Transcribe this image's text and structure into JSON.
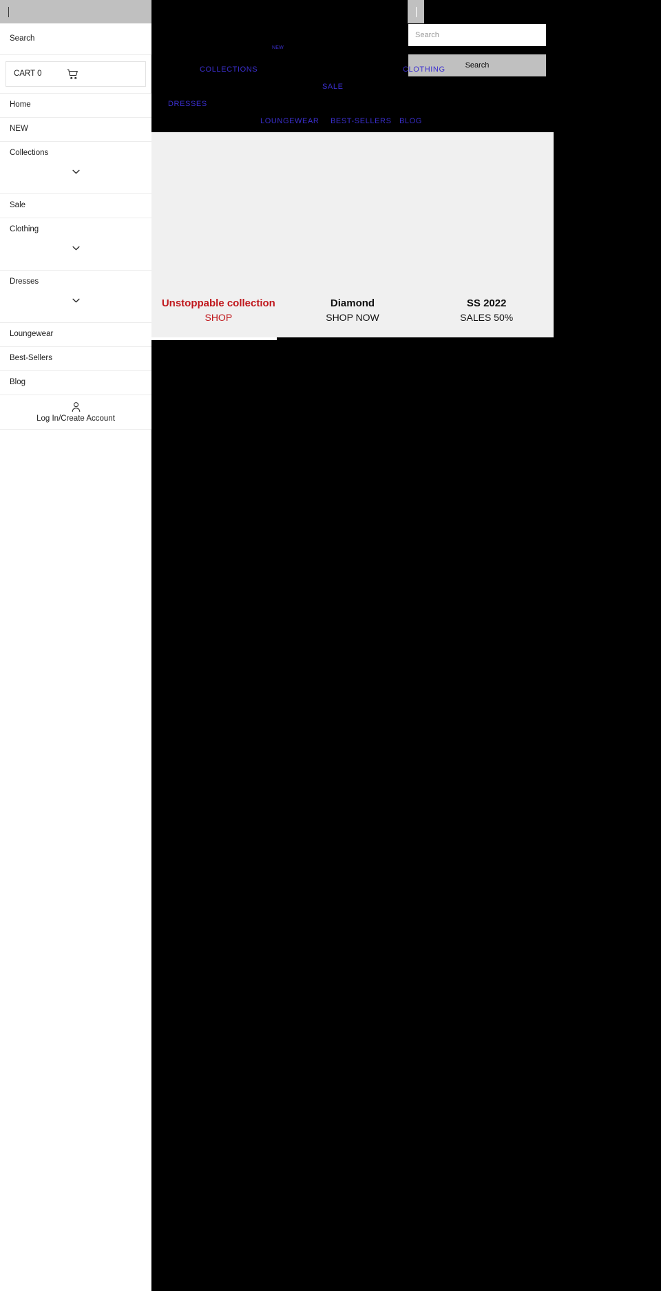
{
  "site": {
    "header": {
      "logo_caret": "|",
      "search": {
        "placeholder": "Search",
        "value": "",
        "button_label": "Search"
      },
      "nav_links": [
        {
          "key": "new",
          "label": "NEW"
        },
        {
          "key": "collections",
          "label": "COLLECTIONS"
        },
        {
          "key": "sale",
          "label": "SALE"
        },
        {
          "key": "clothing",
          "label": "CLOTHING"
        },
        {
          "key": "dresses",
          "label": "DRESSES"
        },
        {
          "key": "loungewear",
          "label": "LOUNGEWEAR"
        },
        {
          "key": "best-sellers",
          "label": "BEST-SELLERS"
        },
        {
          "key": "blog",
          "label": "BLOG"
        }
      ]
    },
    "promos": [
      {
        "title": "Unstoppable collection",
        "subtitle": "SHOP",
        "accent": true,
        "accent_color": "#c0171c"
      },
      {
        "title": "Diamond",
        "subtitle": "SHOP NOW",
        "accent": false,
        "accent_color": "#111111"
      },
      {
        "title": "SS 2022",
        "subtitle": "SALES 50%",
        "accent": false,
        "accent_color": "#111111"
      }
    ]
  },
  "drawer": {
    "top_caret": "|",
    "search": {
      "label": "Search"
    },
    "cart": {
      "label": "CART 0",
      "icon": "shopping-cart-icon"
    },
    "items": [
      {
        "key": "home",
        "label": "Home",
        "expandable": false
      },
      {
        "key": "new",
        "label": "NEW",
        "expandable": false
      },
      {
        "key": "collections",
        "label": "Collections",
        "expandable": true
      },
      {
        "key": "sale",
        "label": "Sale",
        "expandable": false
      },
      {
        "key": "clothing",
        "label": "Clothing",
        "expandable": true
      },
      {
        "key": "dresses",
        "label": "Dresses",
        "expandable": true
      },
      {
        "key": "loungewear",
        "label": "Loungewear",
        "expandable": false
      },
      {
        "key": "best-sellers",
        "label": "Best-Sellers",
        "expandable": false
      },
      {
        "key": "blog",
        "label": "Blog",
        "expandable": false
      }
    ],
    "account": {
      "label": "Log In/Create Account",
      "icon": "person-icon"
    }
  },
  "theme": {
    "drawer_bg": "#ffffff",
    "site_bg": "#000000",
    "promo_bg": "#f0f0f0",
    "link_color": "#3b2fcf",
    "accent_red": "#c0171c",
    "control_gray": "#c0c0c0"
  }
}
